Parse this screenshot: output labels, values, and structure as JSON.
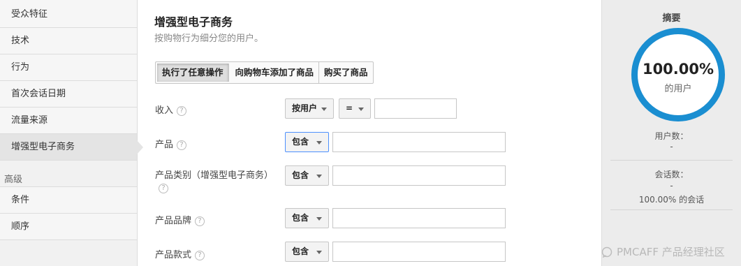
{
  "sidebar": {
    "items": [
      {
        "label": "受众特征"
      },
      {
        "label": "技术"
      },
      {
        "label": "行为"
      },
      {
        "label": "首次会话日期"
      },
      {
        "label": "流量来源"
      },
      {
        "label": "增强型电子商务"
      }
    ],
    "section_label": "高级",
    "advanced_items": [
      {
        "label": "条件"
      },
      {
        "label": "顺序"
      }
    ]
  },
  "main": {
    "title": "增强型电子商务",
    "subtitle": "按购物行为细分您的用户。",
    "tabs": [
      {
        "label": "执行了任意操作"
      },
      {
        "label": "向购物车添加了商品"
      },
      {
        "label": "购买了商品"
      }
    ],
    "rows": {
      "revenue": {
        "label": "收入",
        "scope": "按用户",
        "operator": "=",
        "value": ""
      },
      "product": {
        "label": "产品",
        "match": "包含",
        "value": ""
      },
      "category": {
        "label": "产品类别（增强型电子商务）",
        "match": "包含",
        "value": ""
      },
      "brand": {
        "label": "产品品牌",
        "match": "包含",
        "value": ""
      },
      "variant": {
        "label": "产品款式",
        "match": "包含",
        "value": ""
      }
    },
    "help_glyph": "?"
  },
  "summary": {
    "title": "摘要",
    "percent": "100.00%",
    "percent_caption": "的用户",
    "users_label": "用户数：",
    "users_value": "-",
    "sessions_label": "会话数：",
    "sessions_value": "-",
    "sessions_pct": "100.00% 的会话"
  },
  "watermark": "PMCAFF 产品经理社区",
  "colors": {
    "ring": "#1a8ed1",
    "active_tab_bg": "#dedede",
    "selected_dropdown_border": "#4d90fe"
  }
}
